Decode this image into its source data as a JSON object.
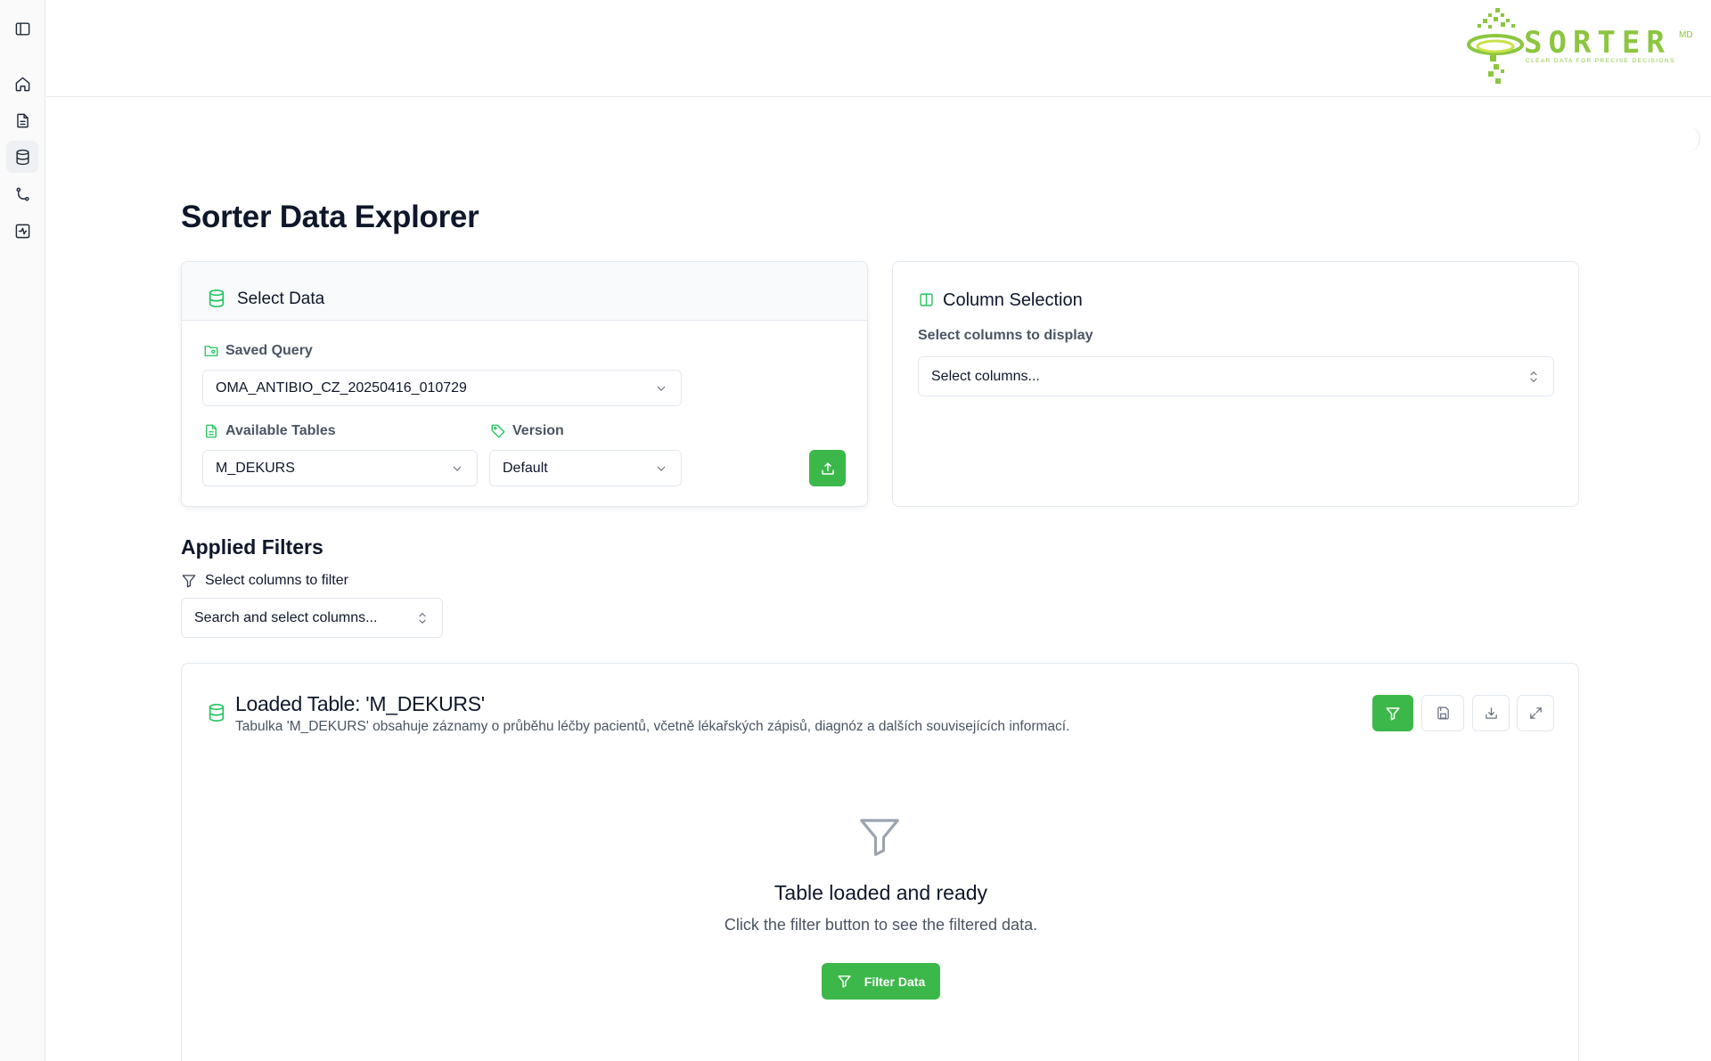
{
  "sidebar": {
    "items": [
      {
        "icon": "sidebar-toggle-icon"
      },
      {
        "icon": "home-icon"
      },
      {
        "icon": "document-icon"
      },
      {
        "icon": "database-icon",
        "active": true
      },
      {
        "icon": "git-branch-icon"
      },
      {
        "icon": "activity-icon"
      }
    ]
  },
  "logo": {
    "word": "SORTER",
    "superscript": "MD",
    "tagline": "CLEAR DATA FOR PRECISE DECISIONS",
    "color": "#8cc63f"
  },
  "page": {
    "title": "Sorter Data Explorer"
  },
  "select_data": {
    "title": "Select Data",
    "saved_query_label": "Saved Query",
    "saved_query_value": "OMA_ANTIBIO_CZ_20250416_010729",
    "available_tables_label": "Available Tables",
    "available_tables_value": "M_DEKURS",
    "version_label": "Version",
    "version_value": "Default"
  },
  "column_selection": {
    "title": "Column Selection",
    "hint": "Select columns to display",
    "placeholder": "Select columns..."
  },
  "filters": {
    "title": "Applied Filters",
    "label": "Select columns to filter",
    "placeholder": "Search and select columns..."
  },
  "loaded_table": {
    "title": "Loaded Table: 'M_DEKURS'",
    "description": "Tabulka 'M_DEKURS' obsahuje záznamy o průběhu léčby pacientů, včetně lékařských zápisů, diagnóz a dalších souvisejících informací.",
    "empty_title": "Table loaded and ready",
    "empty_hint": "Click the filter button to see the filtered data.",
    "filter_button_label": "Filter Data"
  },
  "colors": {
    "accent": "#3cb84a",
    "icon_green": "#22c55e",
    "border": "#e2e8f0"
  }
}
